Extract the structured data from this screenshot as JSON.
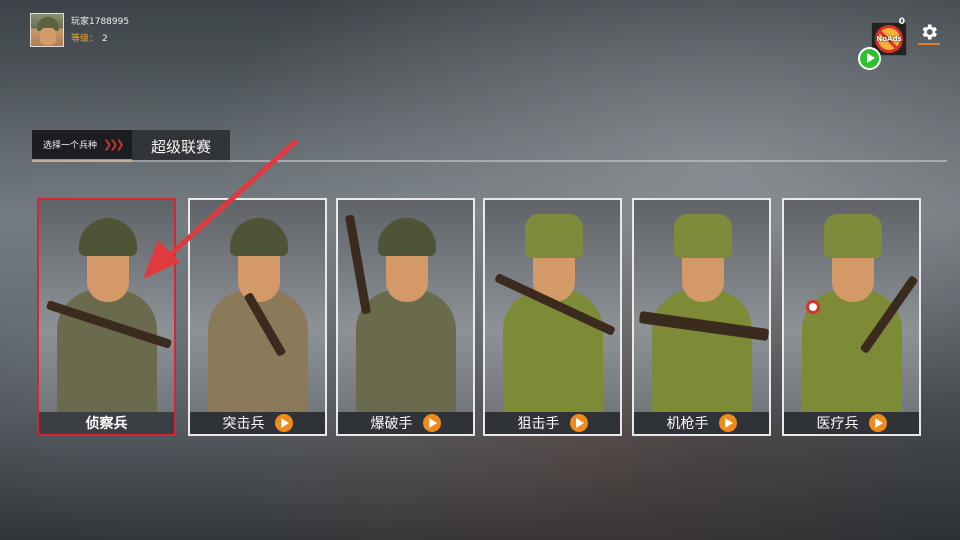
{
  "profile": {
    "player_name": "玩家1788995",
    "level_label": "等级：",
    "level_value": "2"
  },
  "top_right": {
    "noads_label": "NoAds",
    "noads_count": "0"
  },
  "tabs": [
    {
      "label": "选择一个兵种",
      "active": true
    },
    {
      "label": "超级联赛",
      "active": false
    }
  ],
  "units": [
    {
      "name": "侦察兵",
      "selected": true,
      "has_video": false
    },
    {
      "name": "突击兵",
      "selected": false,
      "has_video": true
    },
    {
      "name": "爆破手",
      "selected": false,
      "has_video": true
    },
    {
      "name": "狙击手",
      "selected": false,
      "has_video": true
    },
    {
      "name": "机枪手",
      "selected": false,
      "has_video": true
    },
    {
      "name": "医疗兵",
      "selected": false,
      "has_video": true
    }
  ],
  "colors": {
    "accent": "#e47d2a",
    "selected_border": "#d8252f",
    "arrow": "#e03a3e",
    "video_button": "#f08a1a"
  }
}
